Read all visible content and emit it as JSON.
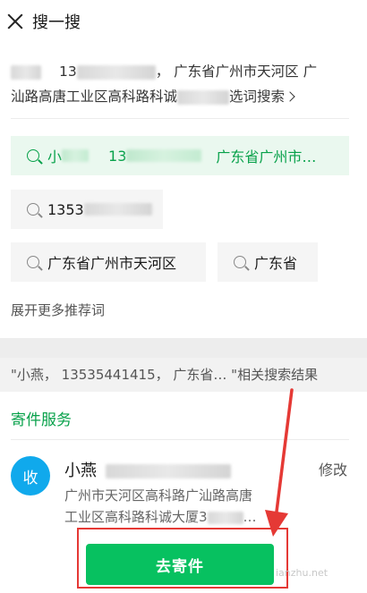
{
  "header": {
    "title": "搜一搜",
    "close_icon": "close-icon"
  },
  "query": {
    "part1": "13",
    "part2": "，  广东省广州市天河区 广",
    "line2": "汕路高唐工业区高科路科诚",
    "link": "选词搜索"
  },
  "chips": [
    {
      "prefix": "小",
      "mid": "13",
      "label": "广东省广州市…",
      "highlighted": true
    },
    {
      "label": "1353"
    },
    {
      "label": "广东省广州市天河区"
    },
    {
      "label": "广东省"
    }
  ],
  "expand_label": "展开更多推荐词",
  "related_text": "\"小燕，  13535441415，  广东省…  \"相关搜索结果",
  "section_title": "寄件服务",
  "sender": {
    "avatar_text": "收",
    "name": "小燕",
    "edit_label": "修改",
    "address_line1": "广州市天河区高科路广汕路高唐",
    "address_line2_a": "工业区高科路科诚大厦3",
    "address_line2_b": "…"
  },
  "ship_button_label": "去寄件",
  "watermark": "ianzhu.net",
  "colors": {
    "accent_green": "#07c160",
    "text_green": "#07a14a",
    "avatar_blue": "#10a9ec",
    "highlight_red": "#e53935"
  }
}
